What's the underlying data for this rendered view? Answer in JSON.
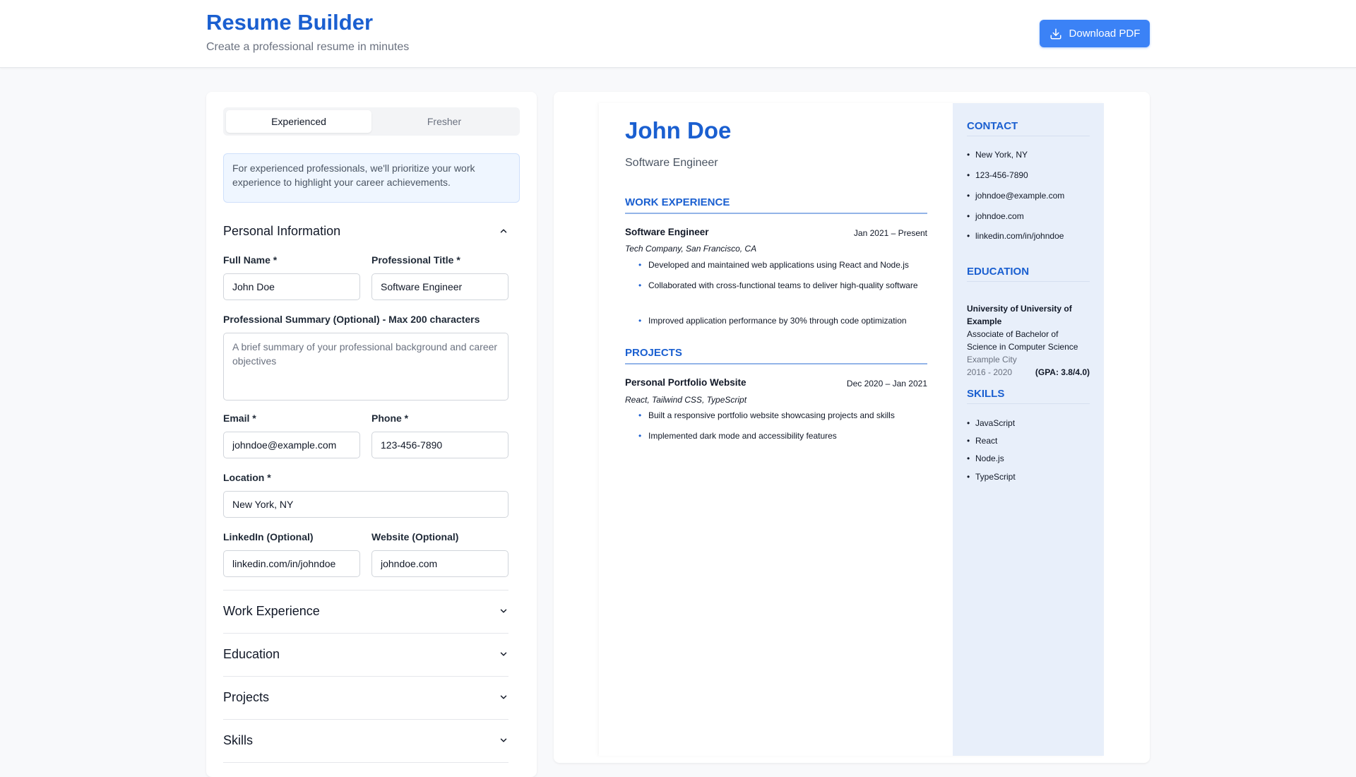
{
  "header": {
    "title": "Resume Builder",
    "subtitle": "Create a professional resume in minutes",
    "download_label": "Download PDF"
  },
  "editor": {
    "mode_options": [
      "Experienced",
      "Fresher"
    ],
    "selected_mode": "Experienced",
    "info_text": "For experienced professionals, we'll prioritize your work experience to highlight your career achievements.",
    "personal": {
      "title": "Personal Information",
      "full_name_label": "Full Name *",
      "full_name_value": "John Doe",
      "prof_title_label": "Professional Title *",
      "prof_title_value": "Software Engineer",
      "summary_label": "Professional Summary (Optional) - Max 200 characters",
      "summary_placeholder": "A brief summary of your professional background and career objectives",
      "email_label": "Email *",
      "email_value": "johndoe@example.com",
      "phone_label": "Phone *",
      "phone_value": "123-456-7890",
      "location_label": "Location *",
      "location_value": "New York, NY",
      "linkedin_label": "LinkedIn (Optional)",
      "linkedin_value": "linkedin.com/in/johndoe",
      "website_label": "Website (Optional)",
      "website_value": "johndoe.com"
    },
    "sections": [
      "Work Experience",
      "Education",
      "Projects",
      "Skills"
    ]
  },
  "resume": {
    "name": "John Doe",
    "title": "Software Engineer",
    "work_heading": "WORK EXPERIENCE",
    "work": [
      {
        "role": "Software Engineer",
        "dates": "Jan 2021 – Present",
        "company": "Tech Company, San Francisco, CA",
        "bullets": [
          "Developed and maintained web applications using React and Node.js",
          "Collaborated with cross-functional teams to deliver high-quality software",
          "Improved application performance by 30% through code optimization"
        ]
      }
    ],
    "projects_heading": "PROJECTS",
    "projects": [
      {
        "name": "Personal Portfolio Website",
        "dates": "Dec 2020 – Jan 2021",
        "tech": "React, Tailwind CSS, TypeScript",
        "bullets": [
          "Built a responsive portfolio website showcasing projects and skills",
          "Implemented dark mode and accessibility features"
        ]
      }
    ],
    "contact_heading": "CONTACT",
    "contact": [
      "New York, NY",
      "123-456-7890",
      "johndoe@example.com",
      "johndoe.com",
      "linkedin.com/in/johndoe"
    ],
    "education_heading": "EDUCATION",
    "education": {
      "university": "University of University of Example",
      "degree": "Associate of Bachelor of Science in Computer Science",
      "city": "Example City",
      "years": "2016 - 2020",
      "gpa": "(GPA: 3.8/4.0)"
    },
    "skills_heading": "SKILLS",
    "skills": [
      "JavaScript",
      "React",
      "Node.js",
      "TypeScript"
    ]
  },
  "colors": {
    "accent": "#1a5fd0",
    "button": "#3b82f6",
    "sidebar_bg": "#e8effa",
    "info_bg": "#eff6ff"
  }
}
